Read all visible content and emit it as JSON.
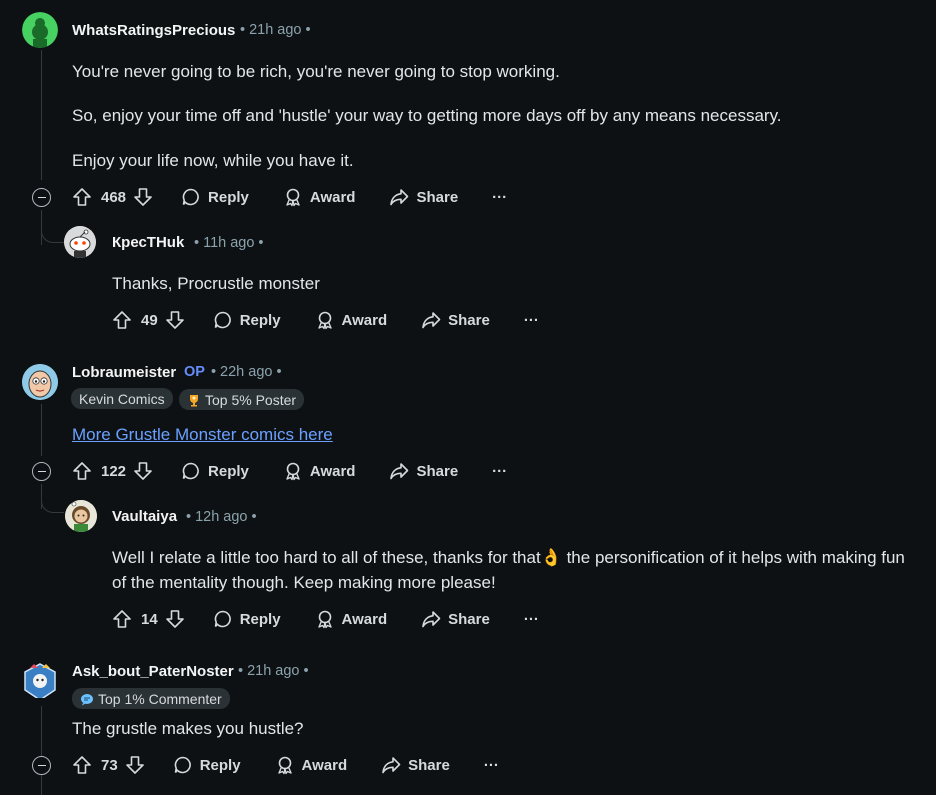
{
  "comments": [
    {
      "username": "WhatsRatingsPrecious",
      "time": "21h ago",
      "paragraphs": [
        "You're never going to be rich, you're never going to stop working.",
        "So, enjoy your time off and 'hustle' your way to getting more days off by any means necessary.",
        "Enjoy your life now, while you have it."
      ],
      "votes": "468",
      "avatar_color": "#46d160"
    },
    {
      "username": "КресТНuk",
      "time": "11h ago",
      "paragraphs": [
        "Thanks, Procrustle monster"
      ],
      "votes": "49"
    },
    {
      "username": "Lobraumeister",
      "op_label": "OP",
      "time": "22h ago",
      "flair": "Kevin Comics",
      "badge": "Top 5% Poster",
      "link_text": "More Grustle Monster comics here",
      "votes": "122"
    },
    {
      "username": "Vaultaiya",
      "time": "12h ago",
      "paragraphs": [
        "Well I relate a little too hard to all of these, thanks for that👌 the personification of it helps with making fun of the mentality though. Keep making more please!"
      ],
      "votes": "14"
    },
    {
      "username": "Ask_bout_PaterNoster",
      "time": "21h ago",
      "badge": "Top 1% Commenter",
      "paragraphs": [
        "The grustle makes you hustle?"
      ],
      "votes": "73"
    }
  ],
  "actions": {
    "reply": "Reply",
    "award": "Award",
    "share": "Share",
    "more": "···"
  },
  "colors": {
    "background": "#0e1113",
    "link": "#6aa1ff",
    "op": "#648efc",
    "meta": "#8ba2ad"
  }
}
